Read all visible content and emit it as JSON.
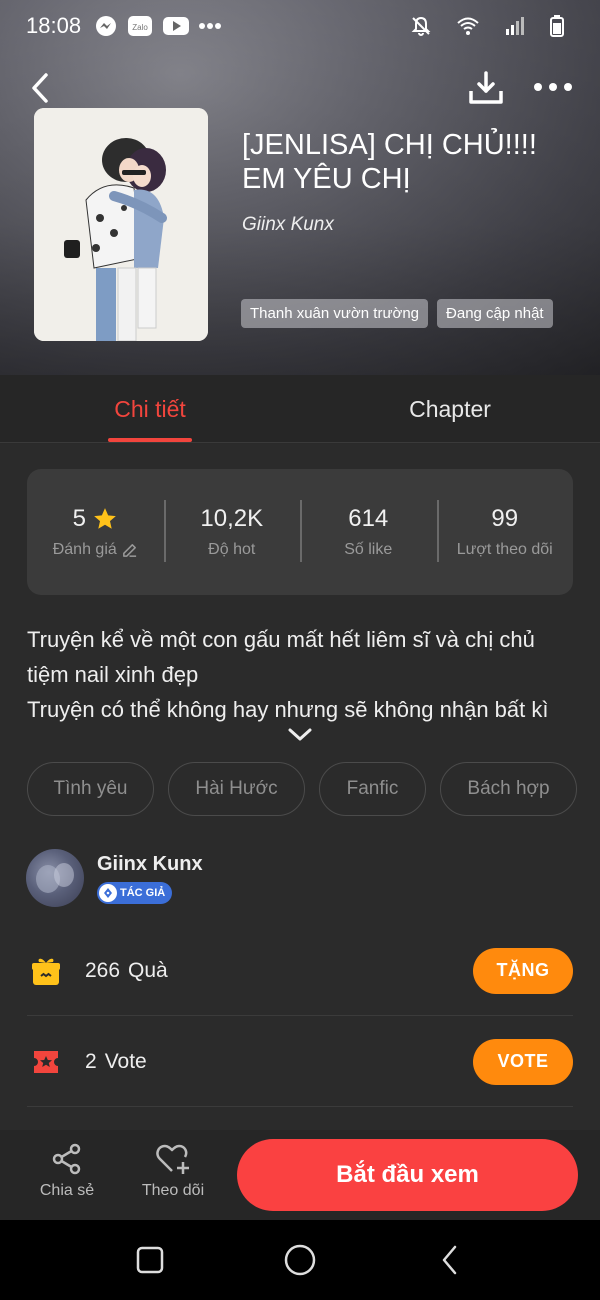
{
  "status_bar": {
    "time": "18:08",
    "left_icons": [
      "messenger-icon",
      "zalo-icon",
      "youtube-icon",
      "more-dots-icon"
    ],
    "zalo_text": "Zalo",
    "right_icons": [
      "mute-bell-icon",
      "wifi-icon",
      "signal-icon",
      "battery-icon"
    ]
  },
  "story": {
    "title": "[JENLISA] CHỊ CHỦ!!!! EM YÊU CHỊ",
    "author": "Giinx Kunx",
    "tags": [
      "Thanh xuân vườn trường",
      "Đang cập nhật"
    ]
  },
  "tabs": [
    {
      "label": "Chi tiết",
      "active": true
    },
    {
      "label": "Chapter",
      "active": false
    }
  ],
  "stats": [
    {
      "value": "5",
      "label": "Đánh giá",
      "icon": "star-icon"
    },
    {
      "value": "10,2K",
      "label": "Độ hot"
    },
    {
      "value": "614",
      "label": "Số like"
    },
    {
      "value": "99",
      "label": "Lượt theo dõi"
    }
  ],
  "description": {
    "line1": "Truyện kể về một con gấu mất hết liêm sĩ và chị chủ tiệm nail xinh đẹp",
    "line2": "Truyện có thể không hay nhưng sẽ không nhận bất kì"
  },
  "genres": [
    "Tình yêu",
    "Hài Hước",
    "Fanfic",
    "Bách hợp"
  ],
  "author_card": {
    "name": "Giinx Kunx",
    "badge": "TÁC GIẢ"
  },
  "gift": {
    "count": "266",
    "label": "Quà",
    "button": "TẶNG"
  },
  "vote": {
    "count": "2",
    "label": "Vote",
    "button": "VOTE"
  },
  "action_bar": {
    "share": "Chia sẻ",
    "follow": "Theo dõi",
    "start": "Bắt đầu xem"
  },
  "colors": {
    "accent_red": "#fa4141",
    "tab_active": "#f2453d",
    "orange": "#ff8a0d",
    "badge_blue": "#3b6ed8",
    "star_yellow": "#ffc21a"
  }
}
